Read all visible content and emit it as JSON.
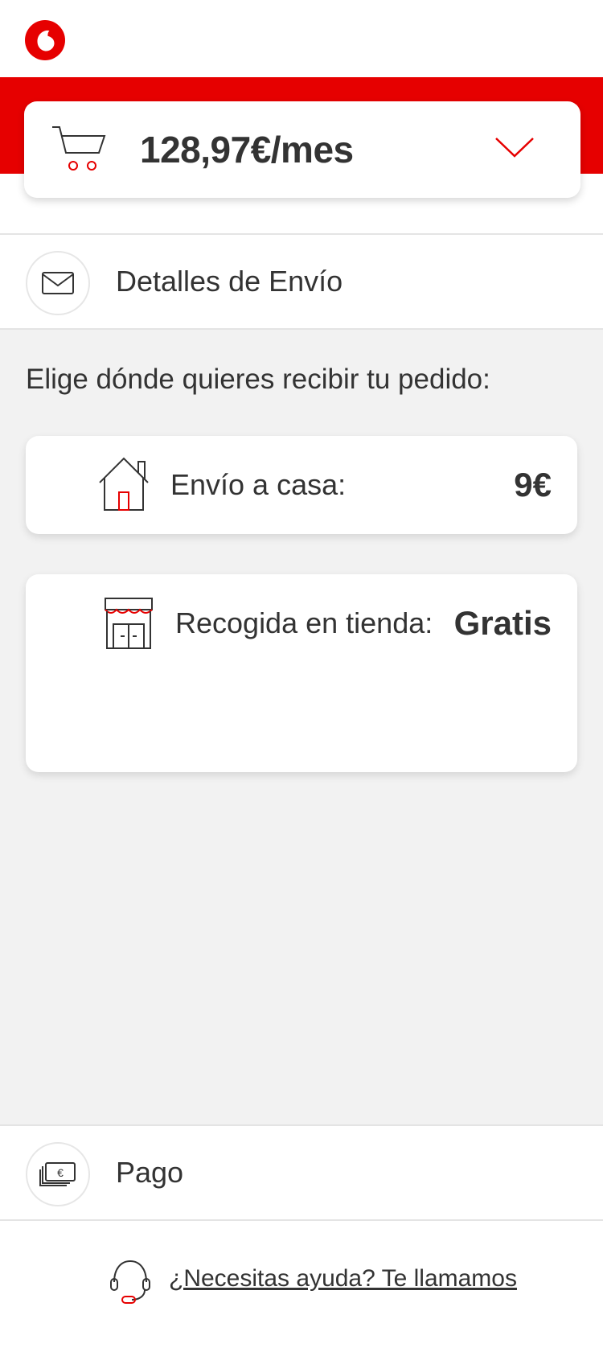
{
  "brand": {
    "name": "Vodafone",
    "color": "#e60000",
    "logo_icon": "vodafone-logo-icon"
  },
  "cart": {
    "price": "128,97€/mes",
    "icon": "shopping-cart-icon",
    "toggle_icon": "chevron-down-icon"
  },
  "shipping_section": {
    "title": "Detalles de Envío",
    "icon": "envelope-icon"
  },
  "delivery": {
    "prompt": "Elige dónde quieres recibir tu pedido:",
    "options": [
      {
        "label": "Envío a casa:",
        "price": "9€",
        "icon": "house-icon"
      },
      {
        "label": "Recogida en tienda:",
        "price": "Gratis",
        "icon": "store-icon"
      }
    ]
  },
  "payment_section": {
    "title": "Pago",
    "icon": "payment-card-icon"
  },
  "help": {
    "link_text": "¿Necesitas ayuda? Te llamamos",
    "icon": "headset-icon"
  }
}
